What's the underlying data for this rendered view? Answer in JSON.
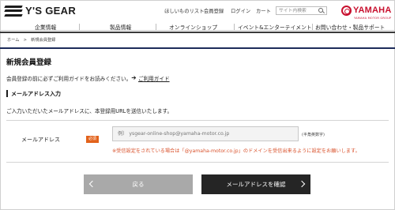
{
  "header": {
    "logo_text": "Y'S GEAR",
    "links": [
      "ほしいものリスト",
      "会員登録",
      "ログイン",
      "カート"
    ],
    "search_placeholder": "サイト内検索",
    "brand": "YAMAHA",
    "brand_sub": "YAMAHA MOTOR GROUP"
  },
  "nav": {
    "items": [
      "企業情報",
      "製品情報",
      "オンラインショップ",
      "イベント&エンターテイメント",
      "お問い合わせ・製品サポート"
    ]
  },
  "breadcrumb": "ホーム　>　新規会員登録",
  "page": {
    "title": "新規会員登録",
    "intro": "会員登録の前に必ずご利用ガイドをお読みください。",
    "guide_link": "ご利用ガイド",
    "section_title": "メールアドレス入力",
    "section_desc": "ご入力いただいたメールアドレスに、本登録用URLを送信いたします。"
  },
  "form": {
    "email_label": "メールアドレス",
    "required_badge": "必須",
    "email_value": "",
    "email_placeholder": "例） ysgear-online-shop@yamaha-motor.co.jp",
    "email_hint": "(半角英数字)",
    "warning": "※受信設定をされている場合は「@yamaha-motor.co.jp」のドメインを受信出来るように設定をお願いします。"
  },
  "buttons": {
    "back": "戻る",
    "confirm": "メールアドレスを確認"
  },
  "colors": {
    "brand_red": "#c8102e",
    "navy_rule": "#1d2b5a",
    "required_orange": "#e2621b",
    "warning_red": "#d9522c",
    "button_dark": "#252525",
    "button_grey": "#a9a9a9"
  },
  "icons": [
    "search-icon",
    "arrow-right-icon",
    "chevron-left-icon",
    "chevron-right-icon"
  ]
}
